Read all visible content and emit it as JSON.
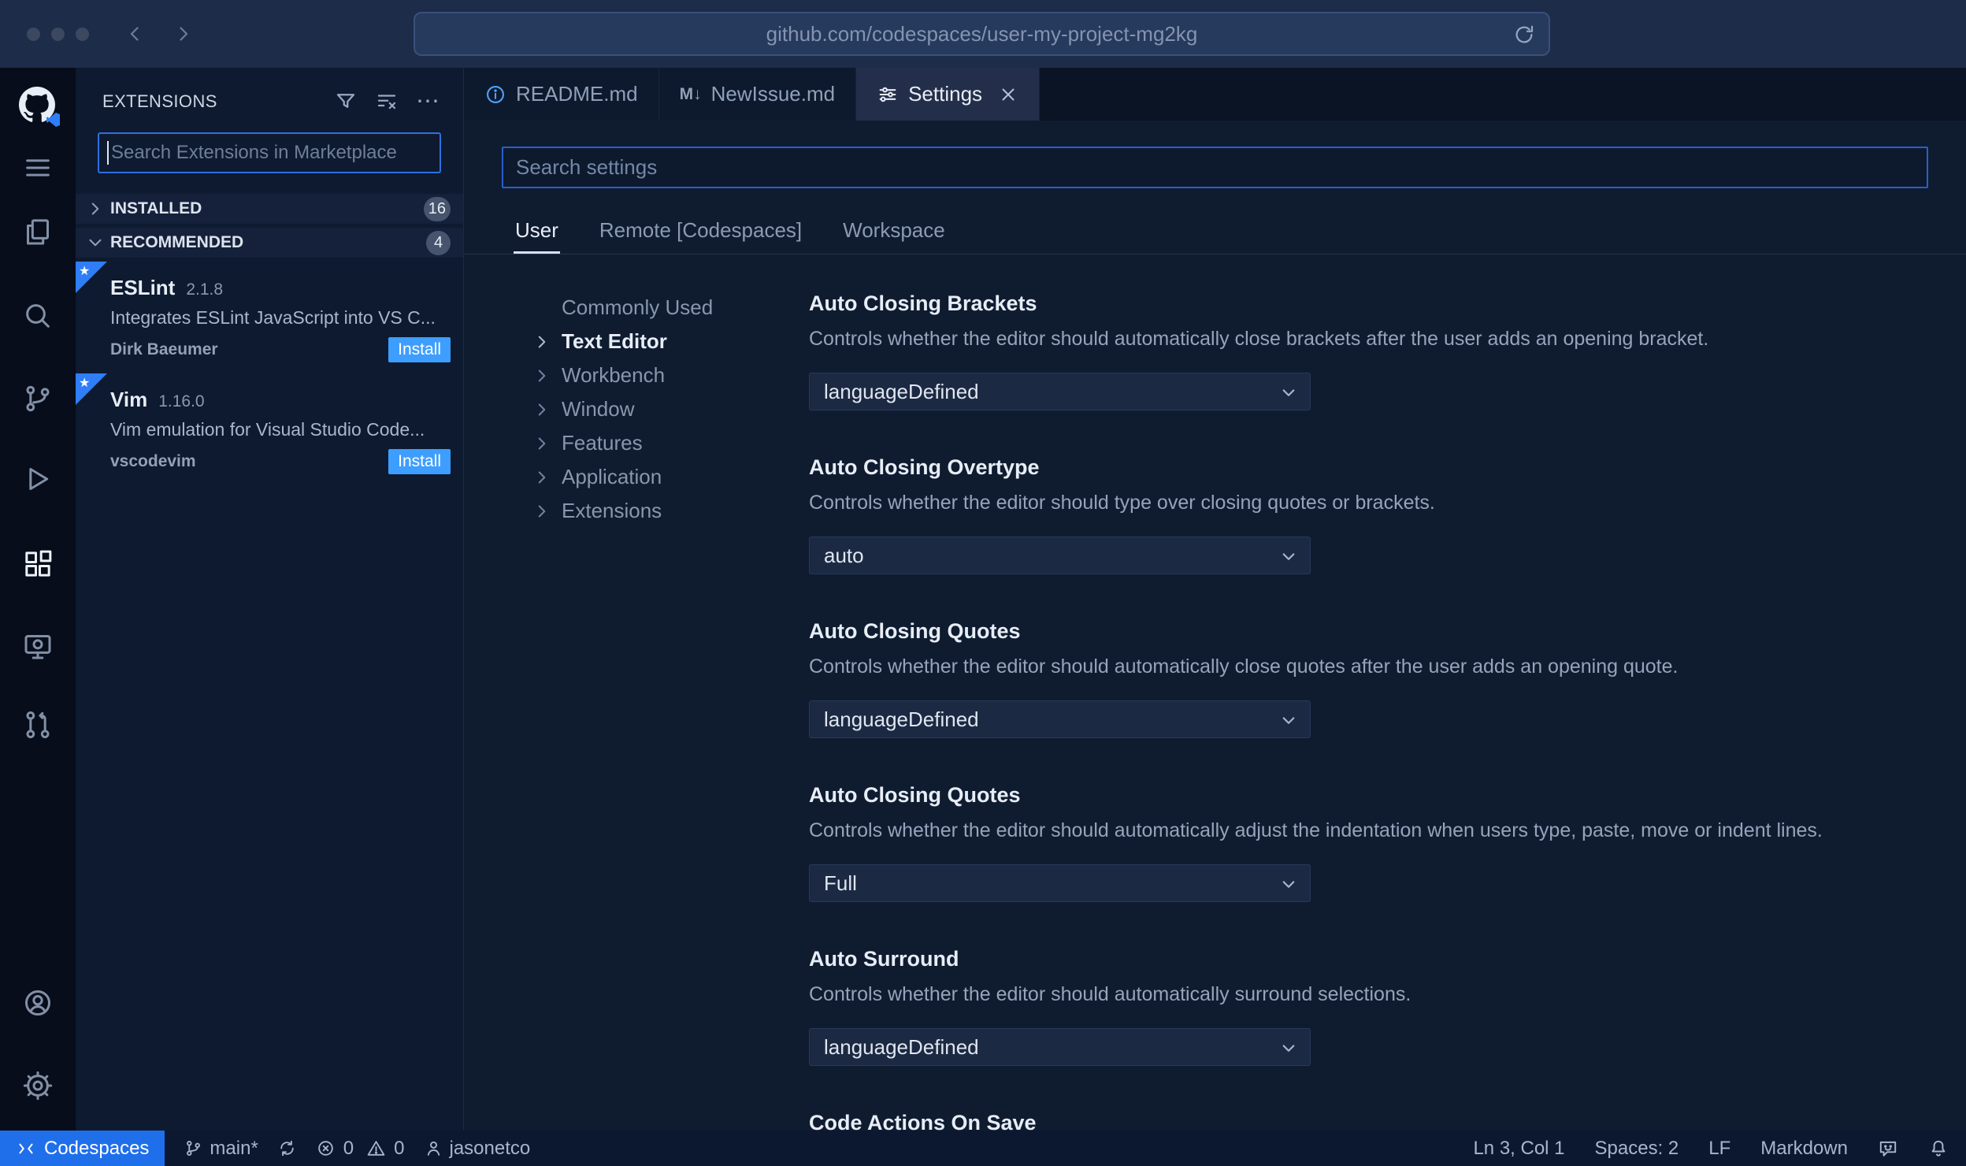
{
  "browser": {
    "url": "github.com/codespaces/user-my-project-mg2kg"
  },
  "sidebar": {
    "title": "EXTENSIONS",
    "search_placeholder": "Search Extensions in Marketplace",
    "sections": [
      {
        "label": "INSTALLED",
        "count": "16"
      },
      {
        "label": "RECOMMENDED",
        "count": "4"
      }
    ],
    "extensions": [
      {
        "name": "ESLint",
        "version": "2.1.8",
        "description": "Integrates ESLint JavaScript into VS C...",
        "author": "Dirk Baeumer",
        "action": "Install"
      },
      {
        "name": "Vim",
        "version": "1.16.0",
        "description": "Vim emulation for Visual Studio Code...",
        "author": "vscodevim",
        "action": "Install"
      }
    ]
  },
  "tabs": [
    {
      "label": "README.md"
    },
    {
      "label": "NewIssue.md"
    },
    {
      "label": "Settings"
    }
  ],
  "settings": {
    "search_placeholder": "Search settings",
    "scopes": [
      {
        "label": "User"
      },
      {
        "label": "Remote [Codespaces]"
      },
      {
        "label": "Workspace"
      }
    ],
    "toc": [
      {
        "label": "Commonly Used"
      },
      {
        "label": "Text Editor"
      },
      {
        "label": "Workbench"
      },
      {
        "label": "Window"
      },
      {
        "label": "Features"
      },
      {
        "label": "Application"
      },
      {
        "label": "Extensions"
      }
    ],
    "items": [
      {
        "title": "Auto Closing Brackets",
        "description": "Controls whether the editor should automatically close brackets after the user adds an opening bracket.",
        "value": "languageDefined"
      },
      {
        "title": "Auto Closing Overtype",
        "description": "Controls whether the editor should type over closing quotes or brackets.",
        "value": "auto"
      },
      {
        "title": "Auto Closing Quotes",
        "description": "Controls whether the editor should automatically close quotes after the user adds an opening quote.",
        "value": "languageDefined"
      },
      {
        "title": "Auto Closing Quotes",
        "description": "Controls whether the editor should automatically adjust the indentation when users type, paste, move or indent lines.",
        "value": "Full"
      },
      {
        "title": "Auto Surround",
        "description": "Controls whether the editor should automatically surround selections.",
        "value": "languageDefined"
      },
      {
        "title": "Code Actions On Save"
      }
    ]
  },
  "status_bar": {
    "codespaces_label": "Codespaces",
    "branch": "main*",
    "error_count": "0",
    "warning_count": "0",
    "user": "jasonetco",
    "line_col": "Ln 3, Col 1",
    "indentation": "Spaces: 2",
    "eol": "LF",
    "language": "Markdown"
  },
  "icons": {
    "ellipsis": "⋯",
    "markdown_tab": "M↓",
    "star": "★"
  },
  "colors": {
    "accent_blue": "#2f7ef7",
    "install_button": "#3d9eff",
    "codespaces_segment": "#1f6feb",
    "badge_bg": "#46546e",
    "search_border": "#2f6fe0"
  }
}
